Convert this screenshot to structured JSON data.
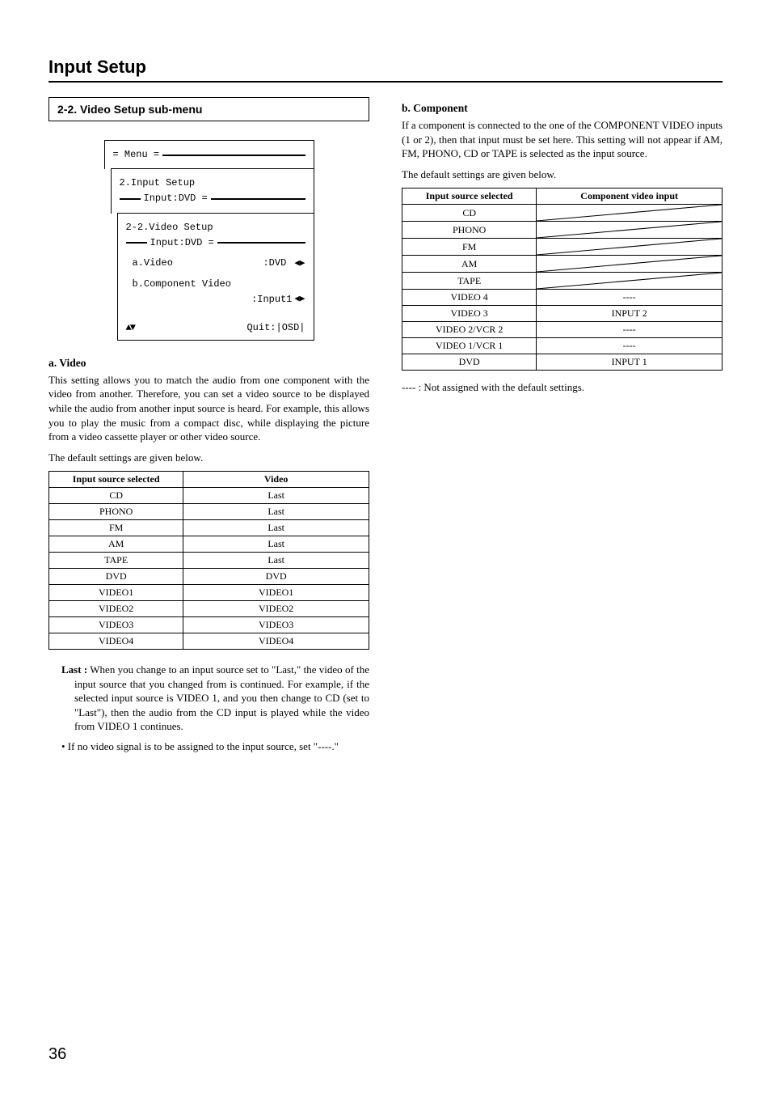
{
  "page_title": "Input Setup",
  "page_number": "36",
  "left": {
    "section_header": "2-2. Video Setup sub-menu",
    "menu": {
      "top": "Menu",
      "l1": "2.Input Setup",
      "l1_sub": "Input:DVD",
      "l2": "2-2.Video Setup",
      "l2_sub": "Input:DVD",
      "a_label": "a.Video",
      "a_value": ":DVD",
      "b_label": "b.Component Video",
      "b_value": ":Input1",
      "footer_quit": "Quit:|OSD|"
    },
    "a_head": "a. Video",
    "a_body": "This setting allows you to match the audio from one component with the video from another. Therefore, you can set a video source to be displayed while the audio from another input source is heard. For example, this allows you to play the music from a compact disc, while displaying the picture from a video cassette player or other video source.",
    "a_defaults": "The default settings are given below.",
    "table_a": {
      "headers": [
        "Input source selected",
        "Video"
      ],
      "rows": [
        [
          "CD",
          "Last"
        ],
        [
          "PHONO",
          "Last"
        ],
        [
          "FM",
          "Last"
        ],
        [
          "AM",
          "Last"
        ],
        [
          "TAPE",
          "Last"
        ],
        [
          "DVD",
          "DVD"
        ],
        [
          "VIDEO1",
          "VIDEO1"
        ],
        [
          "VIDEO2",
          "VIDEO2"
        ],
        [
          "VIDEO3",
          "VIDEO3"
        ],
        [
          "VIDEO4",
          "VIDEO4"
        ]
      ]
    },
    "last_label": "Last :",
    "last_text": " When you change to an input source set to \"Last,\" the video of the input source that you changed from is continued. For example, if the selected input source is VIDEO 1, and you then change to CD (set to \"Last\"), then the audio from the CD input is played while the video from VIDEO 1 continues.",
    "bullet": "• If no video signal is to be assigned to the input source, set \"----.\""
  },
  "right": {
    "b_head": "b. Component",
    "b_body": "If a component is connected to the one of the COMPONENT VIDEO inputs (1 or 2), then that input must be set here. This setting will not appear if AM, FM, PHONO, CD or TAPE is selected as the input source.",
    "b_defaults": "The default settings are given below.",
    "table_b": {
      "headers": [
        "Input source selected",
        "Component video input"
      ],
      "rows": [
        {
          "c0": "CD",
          "diag": true
        },
        {
          "c0": "PHONO",
          "diag": true
        },
        {
          "c0": "FM",
          "diag": true
        },
        {
          "c0": "AM",
          "diag": true
        },
        {
          "c0": "TAPE",
          "diag": true
        },
        {
          "c0": "VIDEO 4",
          "c1": "----"
        },
        {
          "c0": "VIDEO 3",
          "c1": "INPUT 2"
        },
        {
          "c0": "VIDEO 2/VCR 2",
          "c1": "----"
        },
        {
          "c0": "VIDEO 1/VCR 1",
          "c1": "----"
        },
        {
          "c0": "DVD",
          "c1": "INPUT 1"
        }
      ]
    },
    "legend": "---- : Not assigned with the default settings."
  }
}
